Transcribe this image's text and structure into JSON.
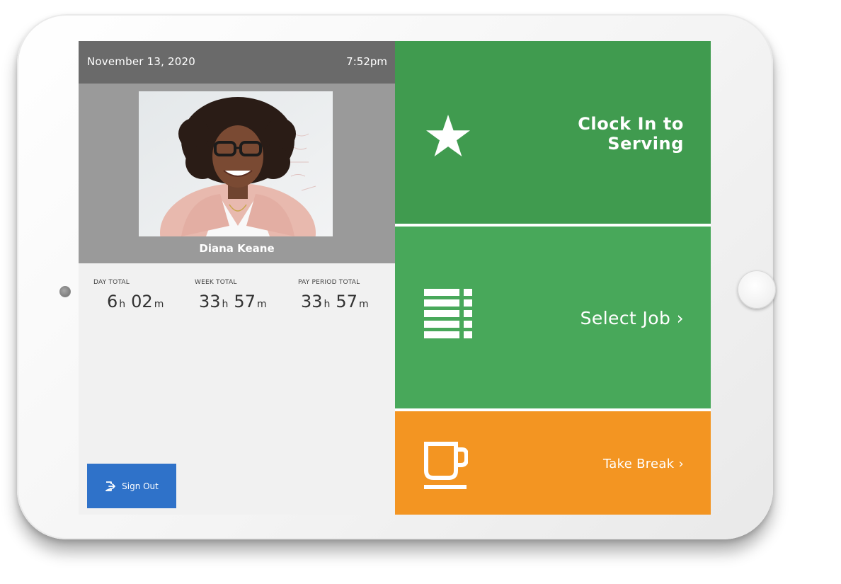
{
  "header": {
    "date": "November 13, 2020",
    "time": "7:52pm"
  },
  "profile": {
    "name": "Diana Keane"
  },
  "totals": {
    "day": {
      "label": "DAY TOTAL",
      "hours": "6",
      "minutes": "02",
      "h_unit": "h",
      "m_unit": "m"
    },
    "week": {
      "label": "WEEK TOTAL",
      "hours": "33",
      "minutes": "57",
      "h_unit": "h",
      "m_unit": "m"
    },
    "pay_period": {
      "label": "PAY PERIOD TOTAL",
      "hours": "33",
      "minutes": "57",
      "h_unit": "h",
      "m_unit": "m"
    }
  },
  "sign_out": {
    "label": "Sign Out"
  },
  "actions": {
    "clock_in": {
      "line1": "Clock In to",
      "line2": "Serving",
      "icon": "star-icon"
    },
    "select_job": {
      "label": "Select Job ›",
      "icon": "list-icon"
    },
    "take_break": {
      "label": "Take Break ›",
      "icon": "coffee-cup-icon"
    }
  },
  "colors": {
    "header_bg": "#6a6a6a",
    "profile_bg": "#9a9a9a",
    "sign_out_bg": "#2f72c9",
    "clock_in_bg": "#409b4f",
    "select_job_bg": "#48a85a",
    "take_break_bg": "#f39522"
  }
}
